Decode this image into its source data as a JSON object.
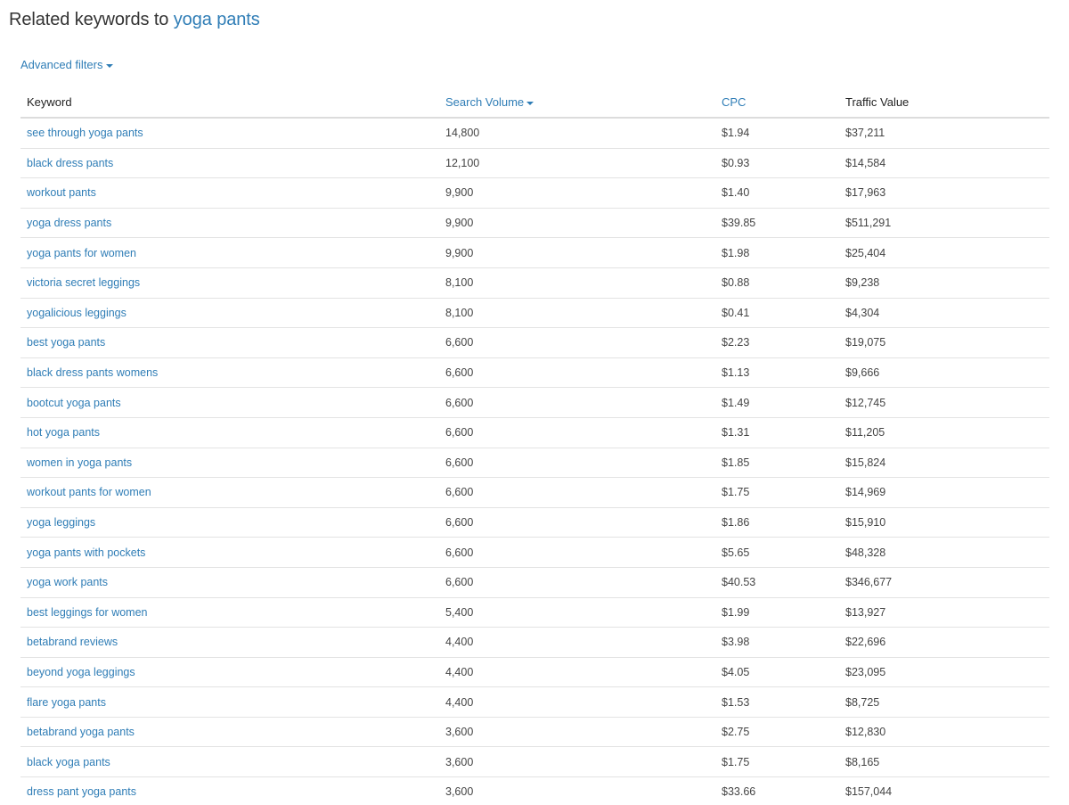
{
  "header": {
    "title_prefix": "Related keywords to ",
    "seed_keyword": "yoga pants"
  },
  "filters": {
    "label": "Advanced filters",
    "icon": "caret-down-icon"
  },
  "table": {
    "columns": [
      {
        "label": "Keyword",
        "sortable": false
      },
      {
        "label": "Search Volume",
        "sortable": true,
        "sorted": "desc",
        "icon": "caret-down-icon"
      },
      {
        "label": "CPC",
        "sortable": true
      },
      {
        "label": "Traffic Value",
        "sortable": false
      }
    ],
    "rows": [
      {
        "keyword": "see through yoga pants",
        "volume": "14,800",
        "cpc": "$1.94",
        "traffic_value": "$37,211"
      },
      {
        "keyword": "black dress pants",
        "volume": "12,100",
        "cpc": "$0.93",
        "traffic_value": "$14,584"
      },
      {
        "keyword": "workout pants",
        "volume": "9,900",
        "cpc": "$1.40",
        "traffic_value": "$17,963"
      },
      {
        "keyword": "yoga dress pants",
        "volume": "9,900",
        "cpc": "$39.85",
        "traffic_value": "$511,291"
      },
      {
        "keyword": "yoga pants for women",
        "volume": "9,900",
        "cpc": "$1.98",
        "traffic_value": "$25,404"
      },
      {
        "keyword": "victoria secret leggings",
        "volume": "8,100",
        "cpc": "$0.88",
        "traffic_value": "$9,238"
      },
      {
        "keyword": "yogalicious leggings",
        "volume": "8,100",
        "cpc": "$0.41",
        "traffic_value": "$4,304"
      },
      {
        "keyword": "best yoga pants",
        "volume": "6,600",
        "cpc": "$2.23",
        "traffic_value": "$19,075"
      },
      {
        "keyword": "black dress pants womens",
        "volume": "6,600",
        "cpc": "$1.13",
        "traffic_value": "$9,666"
      },
      {
        "keyword": "bootcut yoga pants",
        "volume": "6,600",
        "cpc": "$1.49",
        "traffic_value": "$12,745"
      },
      {
        "keyword": "hot yoga pants",
        "volume": "6,600",
        "cpc": "$1.31",
        "traffic_value": "$11,205"
      },
      {
        "keyword": "women in yoga pants",
        "volume": "6,600",
        "cpc": "$1.85",
        "traffic_value": "$15,824"
      },
      {
        "keyword": "workout pants for women",
        "volume": "6,600",
        "cpc": "$1.75",
        "traffic_value": "$14,969"
      },
      {
        "keyword": "yoga leggings",
        "volume": "6,600",
        "cpc": "$1.86",
        "traffic_value": "$15,910"
      },
      {
        "keyword": "yoga pants with pockets",
        "volume": "6,600",
        "cpc": "$5.65",
        "traffic_value": "$48,328"
      },
      {
        "keyword": "yoga work pants",
        "volume": "6,600",
        "cpc": "$40.53",
        "traffic_value": "$346,677"
      },
      {
        "keyword": "best leggings for women",
        "volume": "5,400",
        "cpc": "$1.99",
        "traffic_value": "$13,927"
      },
      {
        "keyword": "betabrand reviews",
        "volume": "4,400",
        "cpc": "$3.98",
        "traffic_value": "$22,696"
      },
      {
        "keyword": "beyond yoga leggings",
        "volume": "4,400",
        "cpc": "$4.05",
        "traffic_value": "$23,095"
      },
      {
        "keyword": "flare yoga pants",
        "volume": "4,400",
        "cpc": "$1.53",
        "traffic_value": "$8,725"
      },
      {
        "keyword": "betabrand yoga pants",
        "volume": "3,600",
        "cpc": "$2.75",
        "traffic_value": "$12,830"
      },
      {
        "keyword": "black yoga pants",
        "volume": "3,600",
        "cpc": "$1.75",
        "traffic_value": "$8,165"
      },
      {
        "keyword": "dress pant yoga pants",
        "volume": "3,600",
        "cpc": "$33.66",
        "traffic_value": "$157,044"
      }
    ]
  },
  "colors": {
    "link": "#2f7db6",
    "text": "#333333",
    "divider": "#e3e3e3"
  }
}
